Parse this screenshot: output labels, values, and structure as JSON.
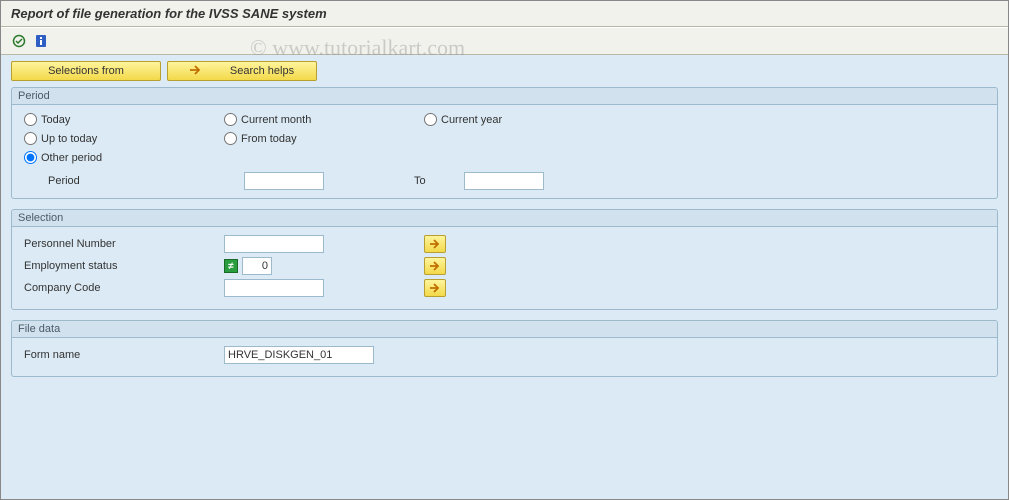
{
  "title": "Report of file generation for the IVSS SANE system",
  "watermark": "© www.tutorialkart.com",
  "toolbar": {
    "selections_from": "Selections from",
    "search_helps": "Search helps"
  },
  "period": {
    "title": "Period",
    "today": "Today",
    "current_month": "Current month",
    "current_year": "Current year",
    "up_to_today": "Up to today",
    "from_today": "From today",
    "other_period": "Other period",
    "period_label": "Period",
    "period_from": "",
    "to_label": "To",
    "period_to": ""
  },
  "selection": {
    "title": "Selection",
    "personnel_number_label": "Personnel Number",
    "personnel_number": "",
    "employment_status_label": "Employment status",
    "employment_status": "0",
    "company_code_label": "Company Code",
    "company_code": ""
  },
  "filedata": {
    "title": "File data",
    "form_name_label": "Form name",
    "form_name": "HRVE_DISKGEN_01"
  }
}
